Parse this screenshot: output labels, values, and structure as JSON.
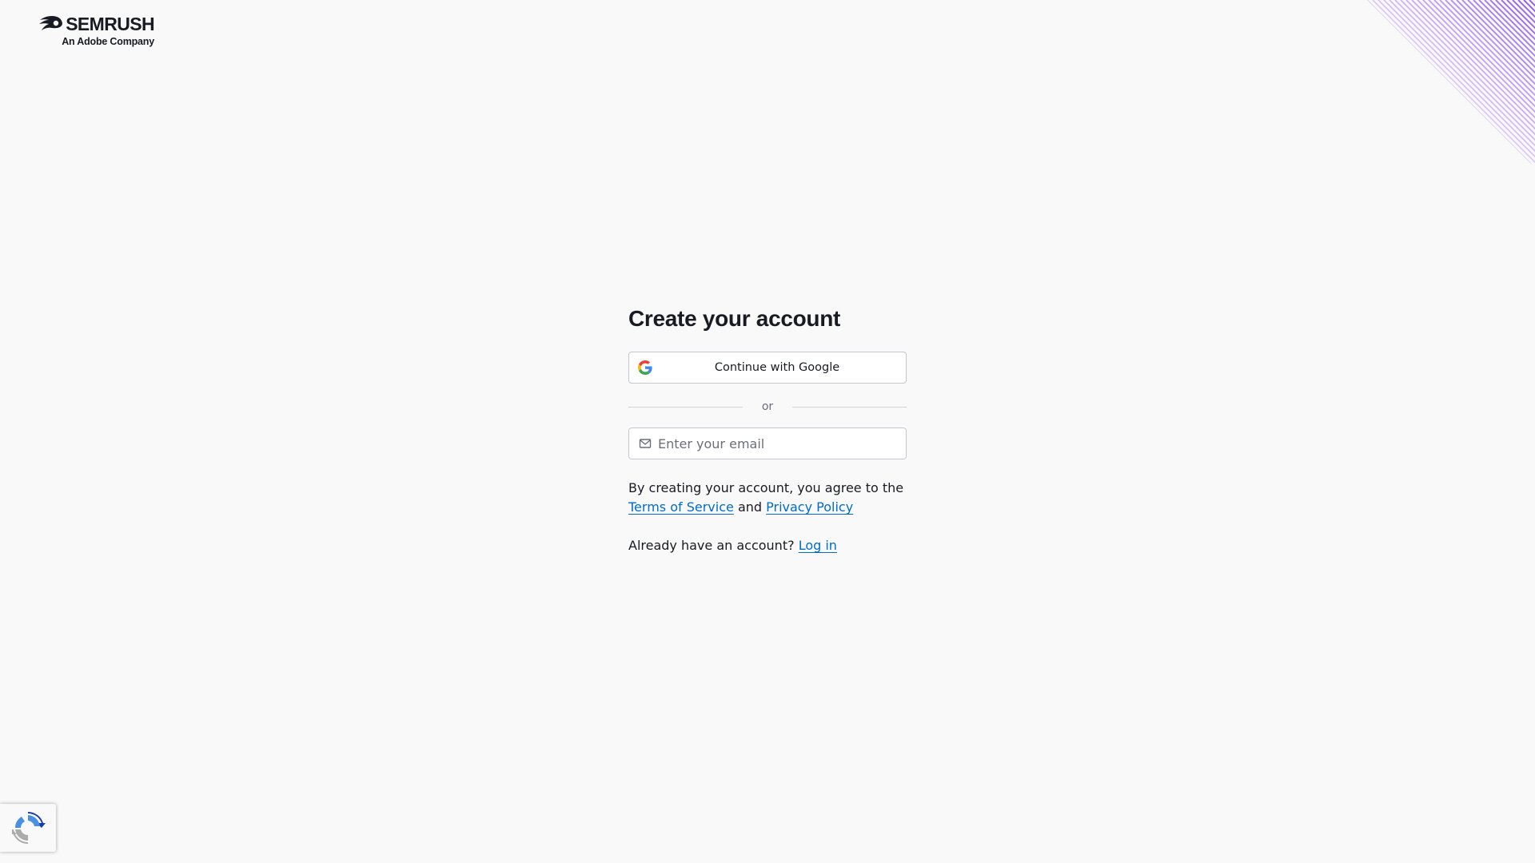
{
  "logo": {
    "brand": "SEMRUSH",
    "subtitle": "An Adobe Company",
    "icon": "semrush-fireball-icon"
  },
  "decoration": {
    "icon": "diagonal-stripes",
    "color": "#8a4dff"
  },
  "form": {
    "title": "Create your account",
    "google_button_label": "Continue with Google",
    "google_icon": "google-g-icon",
    "divider_text": "or",
    "email_placeholder": "Enter your email",
    "email_value": "",
    "email_icon": "mail-icon",
    "terms_prefix": "By creating your account, you agree to the",
    "terms_link": "Terms of Service",
    "terms_and": "and",
    "privacy_link": "Privacy Policy",
    "login_prompt": "Already have an account?",
    "login_link": "Log in"
  },
  "recaptcha": {
    "icon": "recaptcha-icon"
  },
  "colors": {
    "background": "#f9f9f9",
    "text": "#191b23",
    "link": "#006dca",
    "border": "#c4c7cf",
    "muted": "#6c6e79"
  }
}
